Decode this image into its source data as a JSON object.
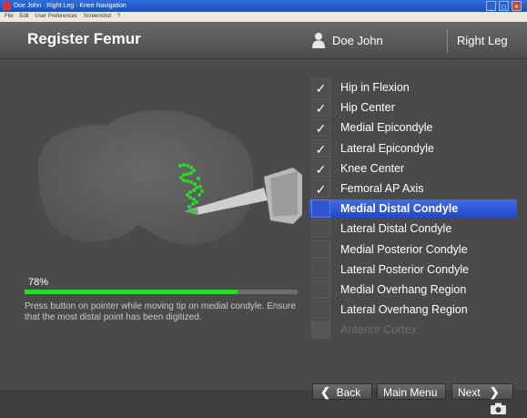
{
  "window": {
    "title": "Doe John · Right Leg · Knee Navigation",
    "menu": [
      "File",
      "Edit",
      "User Preferences",
      "Screenshot",
      "?"
    ]
  },
  "header": {
    "title": "Register Femur",
    "user": "Doe John",
    "leg": "Right Leg",
    "icons": [
      "user-icon"
    ]
  },
  "checklist": {
    "items": [
      {
        "label": "Hip in Flexion",
        "state": "done"
      },
      {
        "label": "Hip Center",
        "state": "done"
      },
      {
        "label": "Medial Epicondyle",
        "state": "done"
      },
      {
        "label": "Lateral Epicondyle",
        "state": "done"
      },
      {
        "label": "Knee Center",
        "state": "done"
      },
      {
        "label": "Femoral AP Axis",
        "state": "done"
      },
      {
        "label": "Medial Distal Condyle",
        "state": "active"
      },
      {
        "label": "Lateral Distal Condyle",
        "state": "pending"
      },
      {
        "label": "Medial Posterior Condyle",
        "state": "pending"
      },
      {
        "label": "Lateral Posterior Condyle",
        "state": "pending"
      },
      {
        "label": "Medial Overhang Region",
        "state": "pending"
      },
      {
        "label": "Lateral Overhang Region",
        "state": "pending"
      },
      {
        "label": "Anterior Cortex",
        "state": "disabled"
      }
    ],
    "check_glyph": "✓"
  },
  "progress": {
    "percent_label": "78%",
    "value": 0.78,
    "color": "#2bd82b"
  },
  "instruction": "Press button on pointer while moving tip on medial condyle. Ensure that the most distal point has been digitized.",
  "footer": {
    "back_label": "Back",
    "main_menu_label": "Main Menu",
    "next_label": "Next",
    "icons": [
      "camera-icon"
    ]
  },
  "colors": {
    "accent": "#2f55d3",
    "background": "#4a4a4a",
    "points": "#2bd82b"
  }
}
